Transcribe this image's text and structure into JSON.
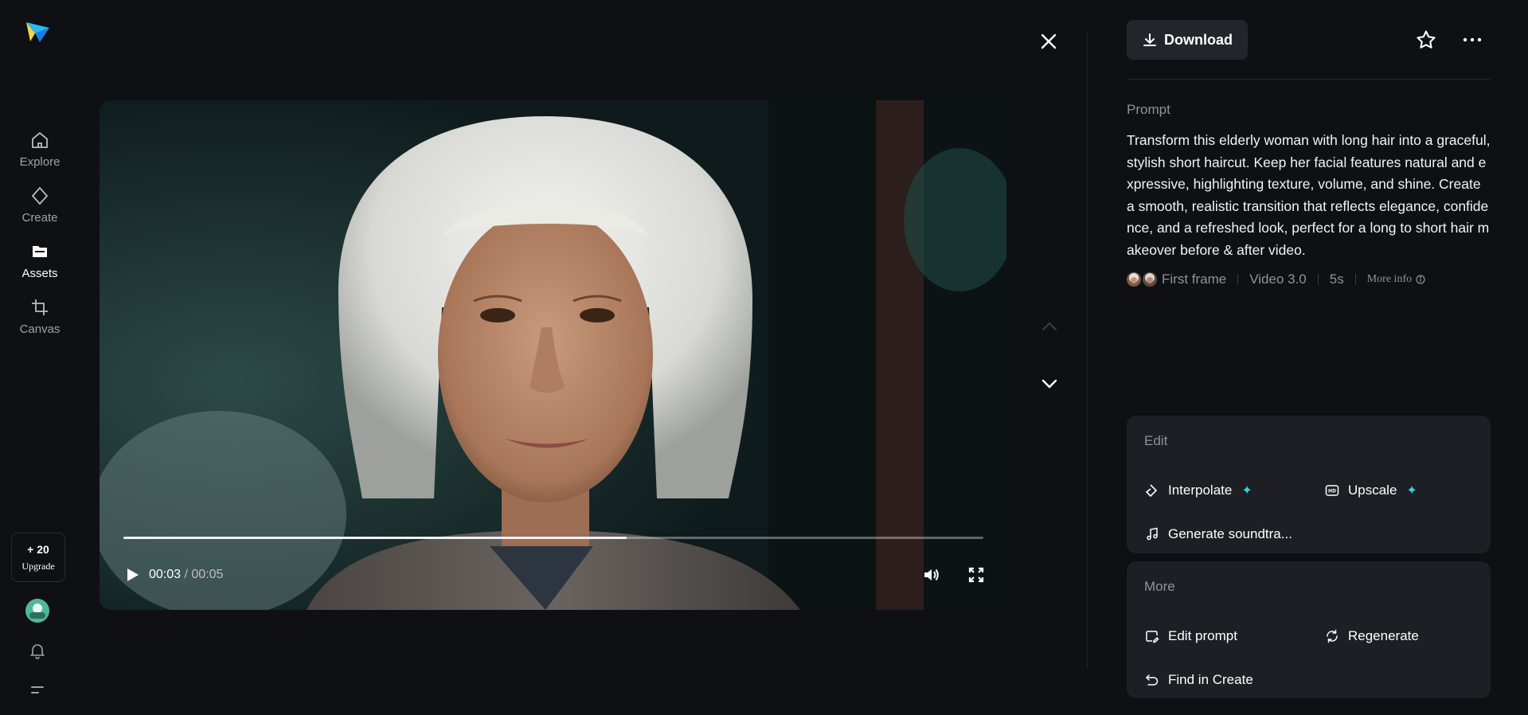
{
  "nav": {
    "items": [
      {
        "label": "Explore",
        "icon": "home-icon"
      },
      {
        "label": "Create",
        "icon": "diamond-icon"
      },
      {
        "label": "Assets",
        "icon": "folder-icon"
      },
      {
        "label": "Canvas",
        "icon": "crop-icon"
      }
    ],
    "active": "Assets",
    "credits": "+ 20",
    "upgrade_label": "Upgrade"
  },
  "player": {
    "current_time": "00:03",
    "separator": " / ",
    "total_time": "00:05",
    "progress_fraction": 0.585
  },
  "panel": {
    "download_label": "Download",
    "prompt_title": "Prompt",
    "prompt_text": "Transform this elderly woman with long hair into a graceful, stylish short haircut. Keep her facial features natural and expressive, highlighting texture, volume, and shine. Create a smooth, realistic transition that reflects elegance, confidence, and a refreshed look, perfect for a long to short hair makeover before & after video.",
    "meta": {
      "first_frame": "First frame",
      "model": "Video 3.0",
      "duration": "5s",
      "more_info": "More info"
    },
    "edit": {
      "title": "Edit",
      "interpolate": "Interpolate",
      "upscale": "Upscale",
      "soundtrack": "Generate soundtra..."
    },
    "more": {
      "title": "More",
      "edit_prompt": "Edit prompt",
      "regenerate": "Regenerate",
      "find_in_create": "Find in Create"
    }
  },
  "colors": {
    "background": "#0f1013",
    "card": "#1d1f24",
    "accent_spark": "#37d0e6"
  }
}
